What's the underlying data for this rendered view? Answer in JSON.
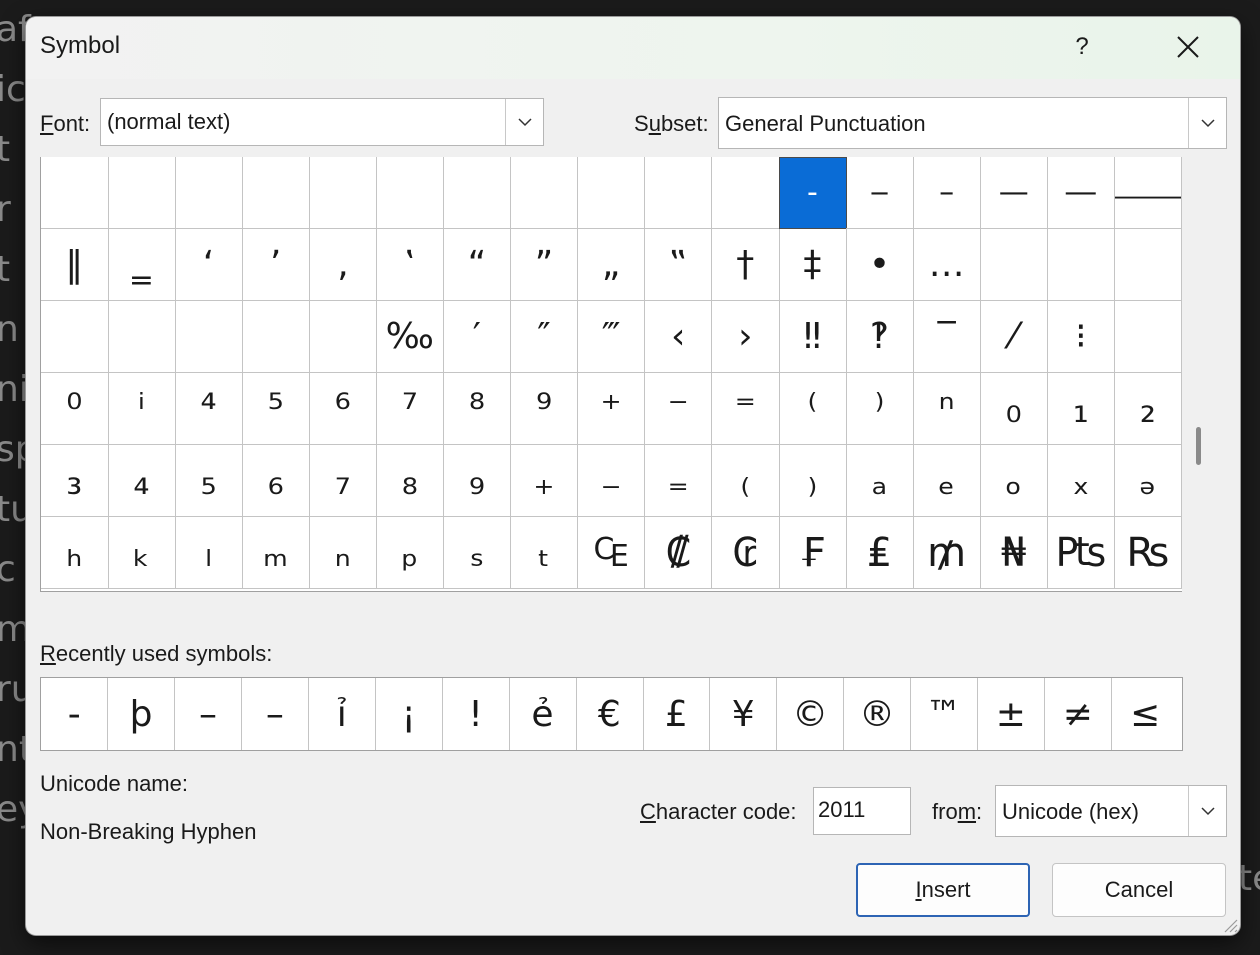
{
  "background_text": [
    "af",
    "ic",
    "t",
    "r",
    "t",
    "n c",
    "ni",
    "sp",
    "tu",
    "c",
    "m",
    "ru",
    "nt",
    "ey"
  ],
  "background_right_text": "te",
  "dialog": {
    "title": "Symbol",
    "help_label": "?",
    "close_label": "✕"
  },
  "font": {
    "label_underlined": "F",
    "label_rest": "ont:",
    "value": "(normal text)"
  },
  "subset": {
    "label_pre": "S",
    "label_underlined": "u",
    "label_rest": "bset:",
    "value": "General Punctuation"
  },
  "symbol_grid": [
    [
      "",
      "",
      "",
      "",
      "",
      "",
      "",
      "",
      "",
      "",
      "",
      "‑",
      "‒",
      "–",
      "—",
      "―",
      "⸻"
    ],
    [
      "‖",
      "‗",
      "‘",
      "’",
      "‚",
      "‛",
      "“",
      "”",
      "„",
      "‟",
      "†",
      "‡",
      "•",
      "…",
      "",
      "",
      ""
    ],
    [
      "",
      "",
      "",
      "",
      "",
      "‰",
      "′",
      "″",
      "‴",
      "‹",
      "›",
      "‼",
      "‽",
      "‾",
      "⁄",
      "⁝",
      ""
    ],
    [
      "⁰",
      "ⁱ",
      "⁴",
      "⁵",
      "⁶",
      "⁷",
      "⁸",
      "⁹",
      "⁺",
      "⁻",
      "⁼",
      "⁽",
      "⁾",
      "ⁿ",
      "₀",
      "₁",
      "₂"
    ],
    [
      "₃",
      "₄",
      "₅",
      "₆",
      "₇",
      "₈",
      "₉",
      "₊",
      "₋",
      "₌",
      "₍",
      "₎",
      "ₐ",
      "ₑ",
      "ₒ",
      "ₓ",
      "ₔ"
    ],
    [
      "ₕ",
      "ₖ",
      "ₗ",
      "ₘ",
      "ₙ",
      "ₚ",
      "ₛ",
      "ₜ",
      "₠",
      "₡",
      "₢",
      "₣",
      "₤",
      "₥",
      "₦",
      "₧",
      "₨"
    ]
  ],
  "selected_symbol": "‑",
  "recent": {
    "label_underlined": "R",
    "label_rest": "ecently used symbols:",
    "symbols": [
      "-",
      "þ",
      "–",
      "–",
      "ỉ",
      "¡",
      "!",
      "ẻ",
      "€",
      "£",
      "¥",
      "©",
      "®",
      "™",
      "±",
      "≠",
      "≤"
    ]
  },
  "unicode_name": {
    "label": "Unicode name:",
    "value": "Non-Breaking Hyphen"
  },
  "char_code": {
    "label_underlined": "C",
    "label_rest": "haracter code:",
    "value": "2011"
  },
  "from": {
    "label_pre": "fro",
    "label_underlined": "m",
    "label_rest": ":",
    "value": "Unicode (hex)"
  },
  "buttons": {
    "insert_underlined": "I",
    "insert_rest": "nsert",
    "cancel": "Cancel"
  }
}
